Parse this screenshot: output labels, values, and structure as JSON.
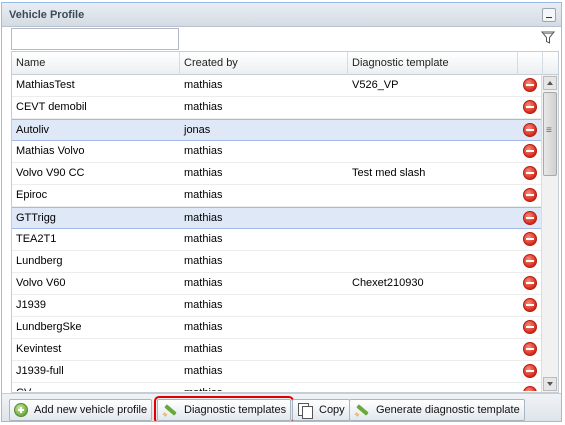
{
  "panel": {
    "title": "Vehicle Profile"
  },
  "filter": {
    "value": "",
    "placeholder": ""
  },
  "grid": {
    "columns": [
      "Name",
      "Created by",
      "Diagnostic template"
    ],
    "rows": [
      {
        "name": "MathiasTest",
        "created_by": "mathias",
        "template": "V526_VP",
        "selected": false
      },
      {
        "name": "CEVT demobil",
        "created_by": "mathias",
        "template": "",
        "selected": false
      },
      {
        "name": "Autoliv",
        "created_by": "jonas",
        "template": "",
        "selected": true
      },
      {
        "name": "Mathias Volvo",
        "created_by": "mathias",
        "template": "",
        "selected": false
      },
      {
        "name": "Volvo V90 CC",
        "created_by": "mathias",
        "template": "Test med slash",
        "selected": false
      },
      {
        "name": "Epiroc",
        "created_by": "mathias",
        "template": "",
        "selected": false
      },
      {
        "name": "GTTrigg",
        "created_by": "mathias",
        "template": "",
        "selected": true
      },
      {
        "name": "TEA2T1",
        "created_by": "mathias",
        "template": "",
        "selected": false
      },
      {
        "name": "Lundberg",
        "created_by": "mathias",
        "template": "",
        "selected": false
      },
      {
        "name": "Volvo V60",
        "created_by": "mathias",
        "template": "Chexet210930",
        "selected": false
      },
      {
        "name": "J1939",
        "created_by": "mathias",
        "template": "",
        "selected": false
      },
      {
        "name": "LundbergSke",
        "created_by": "mathias",
        "template": "",
        "selected": false
      },
      {
        "name": "Kevintest",
        "created_by": "mathias",
        "template": "",
        "selected": false
      },
      {
        "name": "J1939-full",
        "created_by": "mathias",
        "template": "",
        "selected": false
      },
      {
        "name": "CV",
        "created_by": "mathias",
        "template": "",
        "selected": false
      }
    ],
    "delete_icon": "delete-icon"
  },
  "toolbar": {
    "add_label": "Add new vehicle profile",
    "diag_label": "Diagnostic templates",
    "copy_label": "Copy",
    "generate_label": "Generate diagnostic template"
  },
  "colors": {
    "selected_row": "#dfe8f6",
    "highlight_outline": "#e00000",
    "delete_red": "#d42a1a"
  }
}
